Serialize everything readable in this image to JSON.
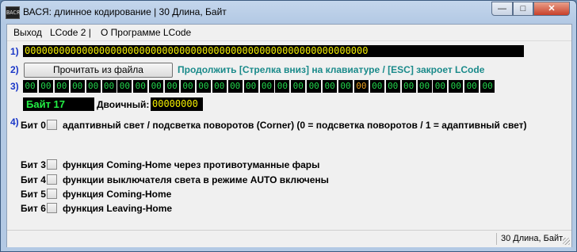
{
  "window": {
    "app_icon_text": "ВАСЯ",
    "title": "ВАСЯ: длинное кодирование   | 30 Длина, Байт",
    "minimize_glyph": "—",
    "maximize_glyph": "□",
    "close_glyph": "✕"
  },
  "menu": {
    "items": [
      "Выход",
      "LCode 2 |",
      "О Программе LCode"
    ]
  },
  "section_numbers": [
    "1)",
    "2)",
    "3)",
    "4)"
  ],
  "long_code": "000000000000000000000000000000000000000000000000000000000000",
  "read_button": "Прочитать из файла",
  "hint": "Продолжить [Стрелка вниз] на клавиатуре / [ESC] закроет LCode",
  "bytes": [
    "00",
    "00",
    "00",
    "00",
    "00",
    "00",
    "00",
    "00",
    "00",
    "00",
    "00",
    "00",
    "00",
    "00",
    "00",
    "00",
    "00",
    "00",
    "00",
    "00",
    "00",
    "00",
    "00",
    "00",
    "00",
    "00",
    "00",
    "00",
    "00",
    "00"
  ],
  "selected_byte_index": 21,
  "byte_label": "Байт 17",
  "binary_label": "Двоичный:",
  "binary_value": "00000000",
  "bits": [
    {
      "label": "Бит 0",
      "text": "адаптивный свет / подсветка поворотов (Corner) (0 = подсветка поворотов / 1 = адаптивный свет)",
      "checked": false
    },
    {
      "label": "Бит 3",
      "text": "функция Coming-Home через противотуманные фары",
      "checked": false
    },
    {
      "label": "Бит 4",
      "text": "функции выключателя света в режиме AUTO включены",
      "checked": false
    },
    {
      "label": "Бит 5",
      "text": "функция Coming-Home",
      "checked": false
    },
    {
      "label": "Бит 6",
      "text": "функция Leaving-Home",
      "checked": false
    }
  ],
  "status": "30 Длина, Байт"
}
